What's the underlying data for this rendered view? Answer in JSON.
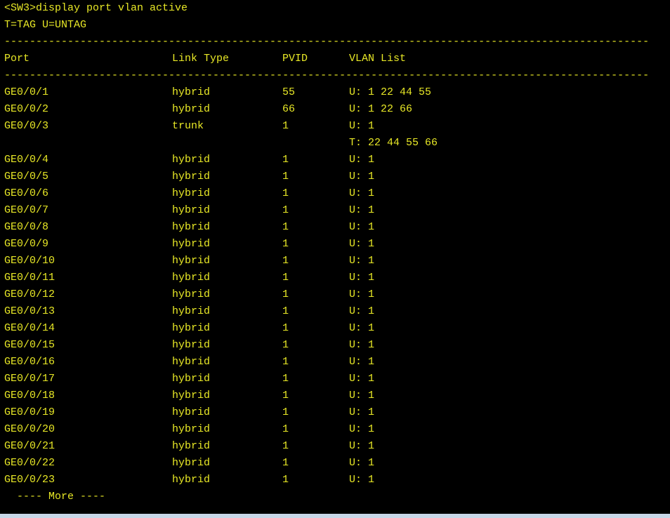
{
  "terminal": {
    "prompt_line": "<SW3>display port vlan active",
    "legend_line": "T=TAG U=UNTAG",
    "separator": "------------------------------------------------------------------------------------------------------",
    "headers": {
      "port": "Port",
      "link_type": "Link Type",
      "pvid": "PVID",
      "vlan_list": "VLAN List"
    },
    "rows": [
      {
        "port": "GE0/0/1",
        "link_type": "hybrid",
        "pvid": "55",
        "vlan_list": "U: 1 22 44 55"
      },
      {
        "port": "GE0/0/2",
        "link_type": "hybrid",
        "pvid": "66",
        "vlan_list": "U: 1 22 66"
      },
      {
        "port": "GE0/0/3",
        "link_type": "trunk",
        "pvid": "1",
        "vlan_list": "U: 1"
      },
      {
        "port": "",
        "link_type": "",
        "pvid": "",
        "vlan_list": "T: 22 44 55 66"
      },
      {
        "port": "GE0/0/4",
        "link_type": "hybrid",
        "pvid": "1",
        "vlan_list": "U: 1"
      },
      {
        "port": "GE0/0/5",
        "link_type": "hybrid",
        "pvid": "1",
        "vlan_list": "U: 1"
      },
      {
        "port": "GE0/0/6",
        "link_type": "hybrid",
        "pvid": "1",
        "vlan_list": "U: 1"
      },
      {
        "port": "GE0/0/7",
        "link_type": "hybrid",
        "pvid": "1",
        "vlan_list": "U: 1"
      },
      {
        "port": "GE0/0/8",
        "link_type": "hybrid",
        "pvid": "1",
        "vlan_list": "U: 1"
      },
      {
        "port": "GE0/0/9",
        "link_type": "hybrid",
        "pvid": "1",
        "vlan_list": "U: 1"
      },
      {
        "port": "GE0/0/10",
        "link_type": "hybrid",
        "pvid": "1",
        "vlan_list": "U: 1"
      },
      {
        "port": "GE0/0/11",
        "link_type": "hybrid",
        "pvid": "1",
        "vlan_list": "U: 1"
      },
      {
        "port": "GE0/0/12",
        "link_type": "hybrid",
        "pvid": "1",
        "vlan_list": "U: 1"
      },
      {
        "port": "GE0/0/13",
        "link_type": "hybrid",
        "pvid": "1",
        "vlan_list": "U: 1"
      },
      {
        "port": "GE0/0/14",
        "link_type": "hybrid",
        "pvid": "1",
        "vlan_list": "U: 1"
      },
      {
        "port": "GE0/0/15",
        "link_type": "hybrid",
        "pvid": "1",
        "vlan_list": "U: 1"
      },
      {
        "port": "GE0/0/16",
        "link_type": "hybrid",
        "pvid": "1",
        "vlan_list": "U: 1"
      },
      {
        "port": "GE0/0/17",
        "link_type": "hybrid",
        "pvid": "1",
        "vlan_list": "U: 1"
      },
      {
        "port": "GE0/0/18",
        "link_type": "hybrid",
        "pvid": "1",
        "vlan_list": "U: 1"
      },
      {
        "port": "GE0/0/19",
        "link_type": "hybrid",
        "pvid": "1",
        "vlan_list": "U: 1"
      },
      {
        "port": "GE0/0/20",
        "link_type": "hybrid",
        "pvid": "1",
        "vlan_list": "U: 1"
      },
      {
        "port": "GE0/0/21",
        "link_type": "hybrid",
        "pvid": "1",
        "vlan_list": "U: 1"
      },
      {
        "port": "GE0/0/22",
        "link_type": "hybrid",
        "pvid": "1",
        "vlan_list": "U: 1"
      },
      {
        "port": "GE0/0/23",
        "link_type": "hybrid",
        "pvid": "1",
        "vlan_list": "U: 1"
      }
    ],
    "more_prompt": "  ---- More ----",
    "colors": {
      "background": "#000000",
      "text": "#e8e826"
    }
  }
}
